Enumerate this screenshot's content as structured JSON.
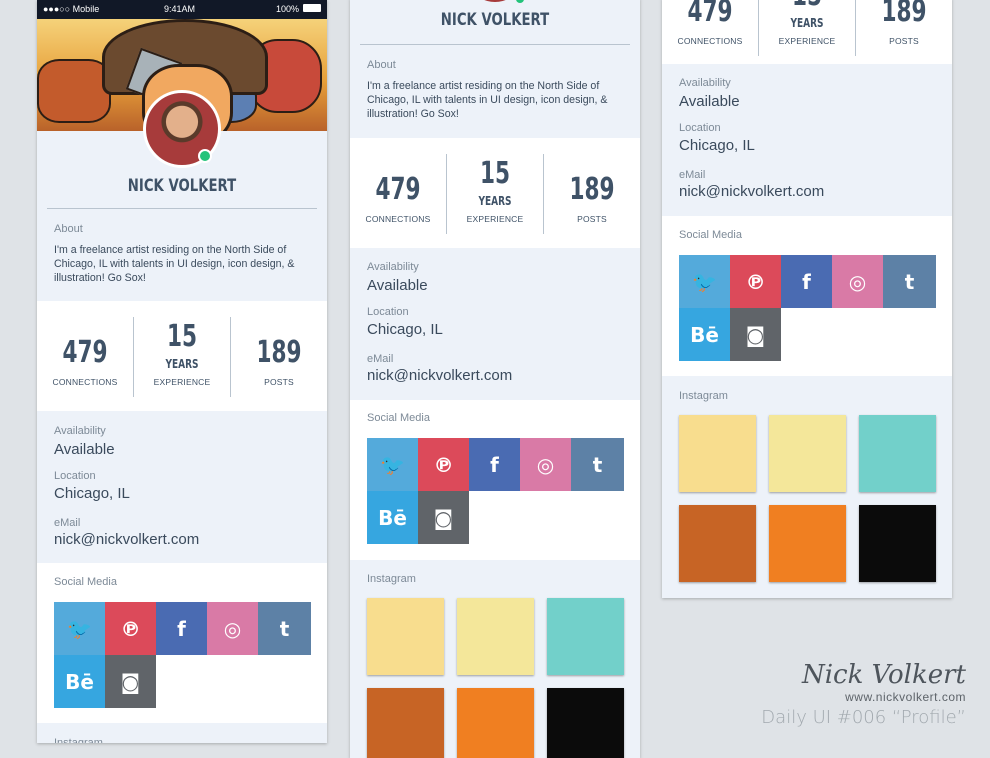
{
  "status_bar": {
    "carrier": "●●●○○ Mobile",
    "time": "9:41AM",
    "battery": "100%"
  },
  "profile": {
    "name": "NICK VOLKERT",
    "about_label": "About",
    "about_text": "I'm a freelance artist residing on the North Side of Chicago, IL with talents in UI design, icon design, & illustration! Go Sox!",
    "stats": [
      {
        "value": "479",
        "label": "CONNECTIONS"
      },
      {
        "value": "15",
        "unit": "YEARS",
        "label": "EXPERIENCE"
      },
      {
        "value": "189",
        "label": "POSTS"
      }
    ],
    "availability_label": "Availability",
    "availability_value": "Available",
    "location_label": "Location",
    "location_value": "Chicago, IL",
    "email_label": "eMail",
    "email_value": "nick@nickvolkert.com",
    "social_label": "Social Media",
    "instagram_label": "Instagram"
  },
  "social_links": [
    {
      "name": "twitter",
      "glyph": "🐦",
      "color": "#54aadb"
    },
    {
      "name": "pinterest",
      "glyph": "℗",
      "color": "#dc4a5a"
    },
    {
      "name": "facebook",
      "glyph": "f",
      "color": "#4a6bb2"
    },
    {
      "name": "dribbble",
      "glyph": "◎",
      "color": "#d97aa6"
    },
    {
      "name": "tumblr",
      "glyph": "t",
      "color": "#5d81a6"
    },
    {
      "name": "behance",
      "glyph": "Bē",
      "color": "#36a6e0"
    },
    {
      "name": "instagram",
      "glyph": "◙",
      "color": "#606469"
    }
  ],
  "instagram_colors": [
    "#f8dd8e",
    "#f4e79a",
    "#72d0ca",
    "#c76425",
    "#f07f21",
    "#0b0b0b"
  ],
  "signature": {
    "hand": "Nick Volkert",
    "url": "www.nickvolkert.com"
  },
  "footer_title": "Daily UI #006 “Profile”"
}
